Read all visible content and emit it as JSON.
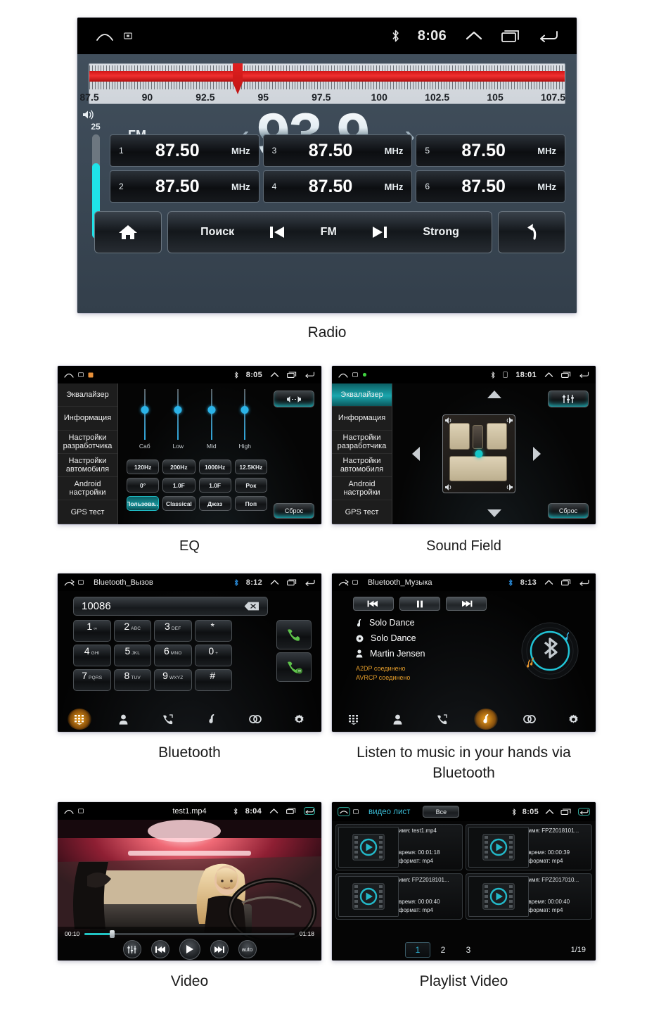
{
  "captions": {
    "radio": "Radio",
    "eq": "EQ",
    "sound_field": "Sound Field",
    "bluetooth": "Bluetooth",
    "bt_music": "Listen to music in your hands via Bluetooth",
    "video": "Video",
    "playlist_video": "Playlist Video"
  },
  "radio": {
    "statusbar": {
      "time": "8:06",
      "bluetooth_icon": "bluetooth-icon"
    },
    "tuner": {
      "ticks": [
        "87.5",
        "90",
        "92.5",
        "95",
        "97.5",
        "100",
        "102.5",
        "105",
        "107.5"
      ],
      "needle_frequency": "93.9",
      "range_min": 87.5,
      "range_max": 108.0
    },
    "volume": {
      "level": "25",
      "percent": 72
    },
    "band": "FM",
    "frequency": "93.9",
    "unit": "MHz",
    "prev_chevron": "‹",
    "next_chevron": "›",
    "presets": [
      {
        "num": "1",
        "freq": "87.50",
        "unit": "MHz"
      },
      {
        "num": "3",
        "freq": "87.50",
        "unit": "MHz"
      },
      {
        "num": "5",
        "freq": "87.50",
        "unit": "MHz"
      },
      {
        "num": "2",
        "freq": "87.50",
        "unit": "MHz"
      },
      {
        "num": "4",
        "freq": "87.50",
        "unit": "MHz"
      },
      {
        "num": "6",
        "freq": "87.50",
        "unit": "MHz"
      }
    ],
    "bottom": {
      "search": "Поиск",
      "band": "FM",
      "strong": "Strong"
    }
  },
  "eq": {
    "statusbar": {
      "time": "8:05"
    },
    "menu": [
      {
        "label": "Эквалайзер",
        "active": false
      },
      {
        "label": "Информация",
        "active": false
      },
      {
        "label": "Настройки разработчика",
        "active": false
      },
      {
        "label": "Настройки автомобиля",
        "active": false
      },
      {
        "label": "Android настройки",
        "active": false
      },
      {
        "label": "GPS тест",
        "active": false
      }
    ],
    "sliders": [
      {
        "label": "Саб"
      },
      {
        "label": "Low"
      },
      {
        "label": "Mid"
      },
      {
        "label": "High"
      }
    ],
    "buttons": [
      {
        "label": "120Hz",
        "on": false
      },
      {
        "label": "200Hz",
        "on": false
      },
      {
        "label": "1000Hz",
        "on": false
      },
      {
        "label": "12.5KHz",
        "on": false
      },
      {
        "label": "0°",
        "on": false
      },
      {
        "label": "1.0F",
        "on": false
      },
      {
        "label": "1.0F",
        "on": false
      },
      {
        "label": "Рок",
        "on": false
      },
      {
        "label": "Пользова...",
        "on": true
      },
      {
        "label": "Classical",
        "on": false
      },
      {
        "label": "Джаз",
        "on": false
      },
      {
        "label": "Поп",
        "on": false
      }
    ],
    "reset": "Сброс"
  },
  "sound_field": {
    "statusbar": {
      "time": "18:01"
    },
    "menu": [
      {
        "label": "Эквалайзер",
        "active": true
      },
      {
        "label": "Информация",
        "active": false
      },
      {
        "label": "Настройки разработчика",
        "active": false
      },
      {
        "label": "Настройки автомобиля",
        "active": false
      },
      {
        "label": "Android настройки",
        "active": false
      },
      {
        "label": "GPS тест",
        "active": false
      }
    ],
    "reset": "Сброс"
  },
  "bluetooth": {
    "title": "Bluetooth_Вызов",
    "statusbar": {
      "time": "8:12"
    },
    "dialed_number": "10086",
    "keys": [
      {
        "digit": "1",
        "letters": "∞"
      },
      {
        "digit": "2",
        "letters": "ABC"
      },
      {
        "digit": "3",
        "letters": "DEF"
      },
      {
        "digit": "*",
        "letters": ""
      },
      {
        "digit": "4",
        "letters": "GHI"
      },
      {
        "digit": "5",
        "letters": "JKL"
      },
      {
        "digit": "6",
        "letters": "MNO"
      },
      {
        "digit": "0",
        "letters": "+"
      },
      {
        "digit": "7",
        "letters": "PQRS"
      },
      {
        "digit": "8",
        "letters": "TUV"
      },
      {
        "digit": "9",
        "letters": "WXYZ"
      },
      {
        "digit": "#",
        "letters": ""
      }
    ],
    "tabs": [
      "keypad-icon",
      "contacts-icon",
      "call-history-icon",
      "music-icon",
      "link-icon",
      "settings-icon"
    ],
    "active_tab": 0
  },
  "bt_music": {
    "title": "Bluetooth_Музыка",
    "statusbar": {
      "time": "8:13"
    },
    "track": "Solo Dance",
    "album": "Solo Dance",
    "artist": "Martin Jensen",
    "a2dp": "A2DP соединено",
    "avrcp": "AVRCP соединено",
    "active_tab": 3
  },
  "video": {
    "title": "test1.mp4",
    "statusbar": {
      "time": "8:04"
    },
    "current_time": "00:10",
    "total_time": "01:18",
    "progress_percent": 13,
    "auto_label": "auto"
  },
  "playlist": {
    "title": "видео лист",
    "filter": "Все",
    "statusbar": {
      "time": "8:05"
    },
    "labels": {
      "name": "имя:",
      "time": "время:",
      "format": "формат:"
    },
    "items": [
      {
        "name": "test1.mp4",
        "time": "00:01:18",
        "format": "mp4"
      },
      {
        "name": "FPZ2018101...",
        "time": "00:00:39",
        "format": "mp4"
      },
      {
        "name": "FPZ2018101...",
        "time": "00:00:40",
        "format": "mp4"
      },
      {
        "name": "FPZ2017010...",
        "time": "00:00:40",
        "format": "mp4"
      }
    ],
    "pages": [
      "1",
      "2",
      "3"
    ],
    "active_page": "1",
    "page_count": "1/19"
  },
  "colors": {
    "accent_cyan": "#1fe3e8",
    "accent_teal": "#17959c",
    "radio_red": "#e02020",
    "amber": "#e09a2a",
    "screen_bg": "#000000"
  }
}
